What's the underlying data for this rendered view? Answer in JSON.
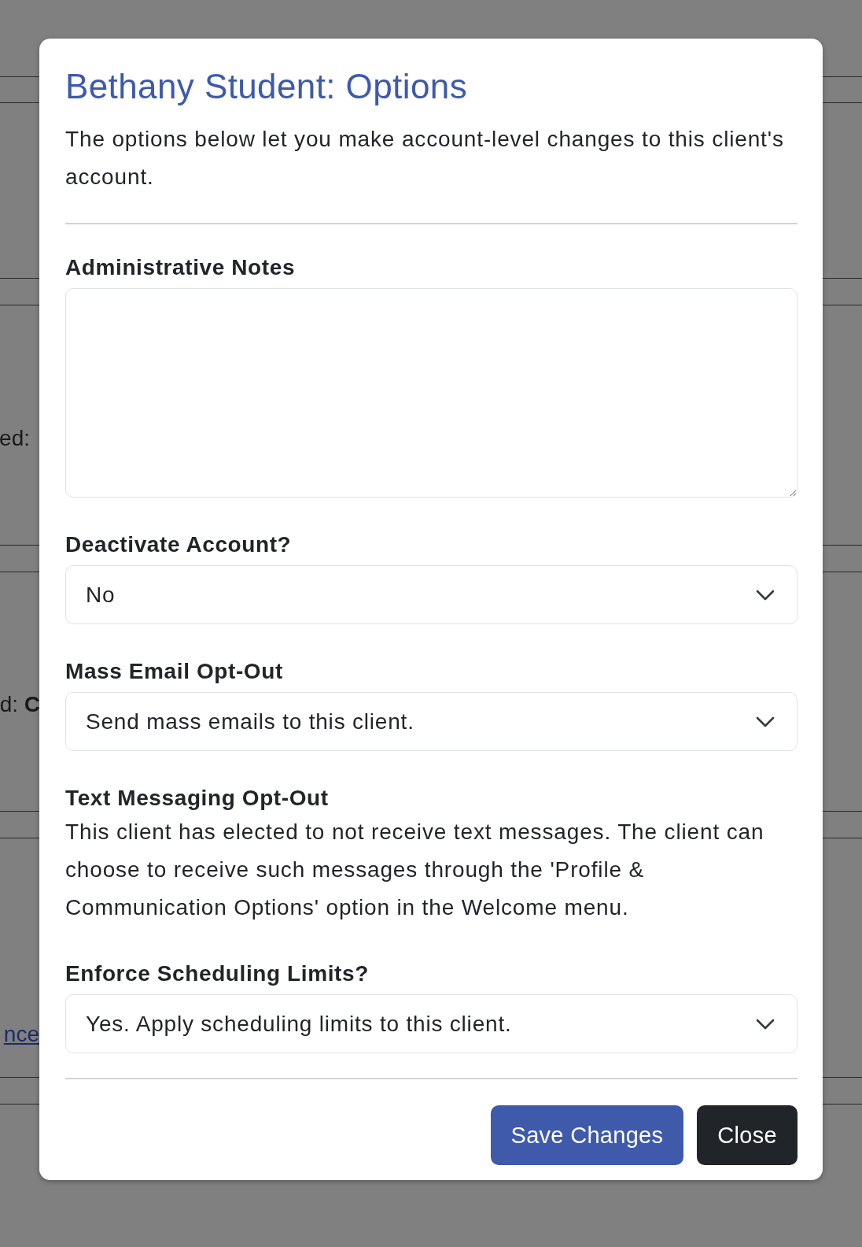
{
  "background": {
    "fragments": [
      {
        "kind": "text",
        "text": "ed:"
      },
      {
        "kind": "label_value",
        "text": "d:",
        "value": "C"
      },
      {
        "kind": "link",
        "text": "nce"
      }
    ]
  },
  "modal": {
    "title": "Bethany Student: Options",
    "description": "The options below let you make account-level changes to this client's account.",
    "fields": [
      {
        "kind": "textarea",
        "label": "Administrative Notes"
      },
      {
        "kind": "select",
        "label": "Deactivate Account?",
        "value": "No"
      },
      {
        "kind": "select",
        "label": "Mass Email Opt-Out",
        "value": "Send mass emails to this client."
      },
      {
        "kind": "info",
        "label": "Text Messaging Opt-Out",
        "text": "This client has elected to not receive text messages. The client can choose to receive such messages through the 'Profile & Communication Options' option in the Welcome menu."
      },
      {
        "kind": "select",
        "label": "Enforce Scheduling Limits?",
        "value": "Yes. Apply scheduling limits to this client."
      }
    ],
    "buttons": [
      {
        "kind": "primary",
        "label": "Save Changes"
      },
      {
        "kind": "secondary",
        "label": "Close"
      }
    ]
  }
}
